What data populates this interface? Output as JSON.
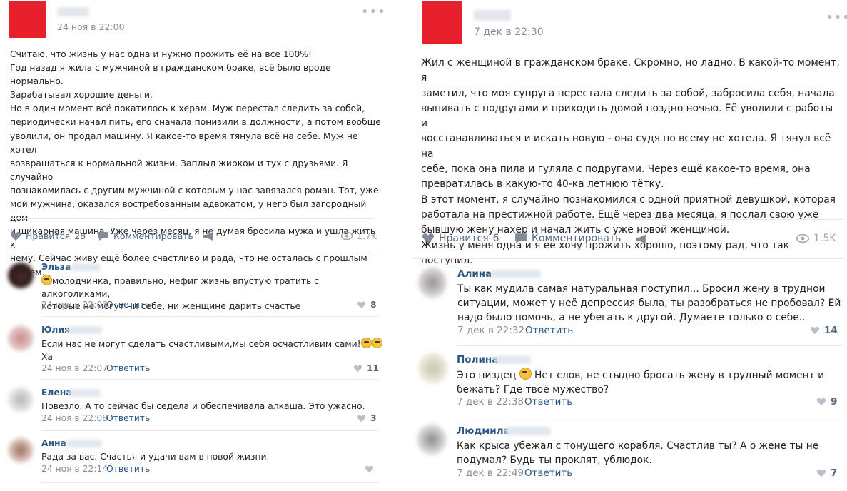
{
  "left_post": {
    "date": "24 ноя в 22:00",
    "text": [
      "Считаю, что жизнь у нас одна и нужно прожить её на все 100%!",
      "Год назад я жила с мужчиной в гражданском браке, всё было вроде нормально.",
      "Зарабатывал хорошие деньги.",
      "Но в один момент всё покатилось к херам. Муж перестал следить за собой,",
      "периодически начал пить, его сначала понизили в должности, а потом вообще",
      "уволили, он продал машину. Я какое-то время тянула всё на себе. Муж не хотел",
      "возвращаться к нормальной жизни. Заплыл жирком и тух с друзьями. Я случайно",
      "познакомилась с другим мужчиной с которым у нас завязался роман. Тот, уже",
      "мой мужчина, оказался востребованным адвокатом, у него был загородный дом",
      "и шикарная машина. Уже через месяц, я не думая бросила мужа и ушла жить к",
      "нему. Сейчас живу ещё более счастливо и рада, что не осталась с прошлым",
      "мужем."
    ],
    "like_label": "Нравится",
    "like_count": "28",
    "comment_label": "Комментировать",
    "views": "1.7K",
    "comments": [
      {
        "name": "Эльза",
        "text": [
          "молодчинка, правильно, нефиг жизнь впустую тратить с алкоголиками,",
          "которые не могут ни себе, ни женщине дарить счастье"
        ],
        "date": "24 ноя в 22:03",
        "reply": "Ответить",
        "likes": "8"
      },
      {
        "name": "Юлия",
        "text": [
          "Если нас не могут сделать счастливыми,мы себя осчастливим сами!",
          "Ха"
        ],
        "date": "24 ноя в 22:07",
        "reply": "Ответить",
        "likes": "11"
      },
      {
        "name": "Елена",
        "text": [
          "Повезло. А то сейчас бы седела и обеспечивала алкаша. Это ужасно."
        ],
        "date": "24 ноя в 22:08",
        "reply": "Ответить",
        "likes": "3"
      },
      {
        "name": "Анна",
        "text": [
          "Рада за вас. Счастья и удачи вам в новой жизни."
        ],
        "date": "24 ноя в 22:14",
        "reply": "Ответить",
        "likes": ""
      }
    ]
  },
  "right_post": {
    "date": "7 дек в 22:30",
    "text": [
      "Жил с женщиной в гражданском браке. Скромно, но ладно. В какой-то момент, я",
      "заметил, что моя супруга перестала следить за собой, забросила себя, начала",
      "выпивать с подругами и приходить домой поздно ночью. Её уволили с работы и",
      "восстанавливаться и искать новую - она судя по всему не хотела. Я тянул всё на",
      "себе, пока она пила и гуляла с подругами. Через ещё какое-то время, она",
      "превратилась в какую-то 40-ка летнюю тётку.",
      "В этот момент, я случайно познакомился с одной приятной девушкой, которая",
      "работала на престижной работе. Ещё через два месяца, я послал свою уже",
      "бывшую жену нахер и начал жить с уже новой женщиной.",
      "Жизнь у меня одна и я её хочу прожить хорошо, поэтому рад, что так поступил."
    ],
    "like_label": "Нравится",
    "like_count": "6",
    "comment_label": "Комментировать",
    "views": "1.5K",
    "comments": [
      {
        "name": "Алина",
        "text": [
          "Ты как мудила самая натуральная поступил... Бросил жену в трудной",
          "ситуации, может у неё депрессия была, ты разобраться не пробовал? Ей",
          "надо было помочь, а не убегать к другой. Думаете только о себе.."
        ],
        "date": "7 дек в 22:32",
        "reply": "Ответить",
        "likes": "14"
      },
      {
        "name": "Полина",
        "text": [
          "Это пиздец",
          " Нет слов, не стыдно бросать жену в трудный момент и",
          "бежать? Где твоё мужество?"
        ],
        "date": "7 дек в 22:38",
        "reply": "Ответить",
        "likes": "9"
      },
      {
        "name": "Людмила",
        "text": [
          "Как крыса убежал с тонущего корабля. Счастлив ты? А о жене ты не",
          "подумал? Будь ты проклят, ублюдок."
        ],
        "date": "7 дек в 22:49",
        "reply": "Ответить",
        "likes": "7"
      }
    ]
  },
  "colors": {
    "avatar": "#e8202c",
    "link": "#2a5885",
    "action": "#55677d",
    "muted": "#8a8f96"
  }
}
